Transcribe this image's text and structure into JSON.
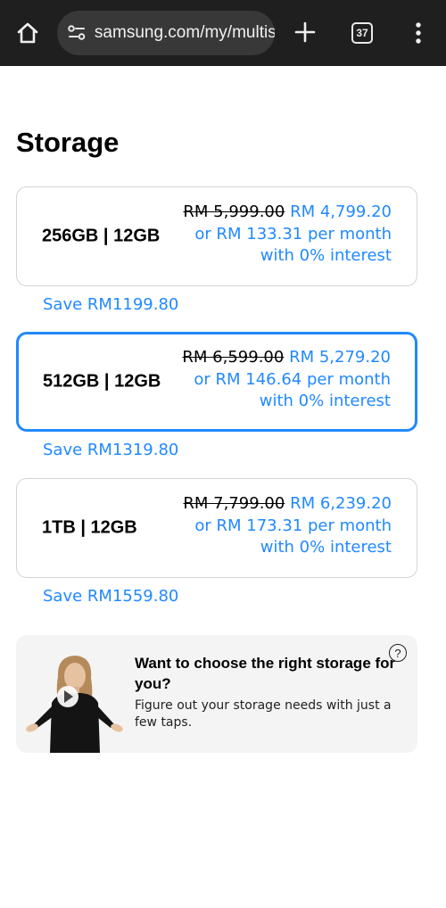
{
  "browser": {
    "url": "samsung.com/my/multisto",
    "tab_count": "37",
    "icons": {
      "home": "home-icon",
      "site_settings": "tune-icon",
      "new_tab": "plus-icon",
      "tabs": "tab-switcher-icon",
      "menu": "more-vert-icon"
    }
  },
  "storage": {
    "title": "Storage",
    "options": [
      {
        "name": "256GB | 12GB",
        "old_price": "RM 5,999.00",
        "new_price": "RM 4,799.20",
        "monthly": "or RM 133.31 per month",
        "interest": "with 0% interest",
        "save": "Save RM1199.80",
        "selected": false
      },
      {
        "name": "512GB | 12GB",
        "old_price": "RM 6,599.00",
        "new_price": "RM 5,279.20",
        "monthly": "or RM 146.64 per month",
        "interest": "with 0% interest",
        "save": "Save RM1319.80",
        "selected": true
      },
      {
        "name": "1TB | 12GB",
        "old_price": "RM 7,799.00",
        "new_price": "RM 6,239.20",
        "monthly": "or RM 173.31 per month",
        "interest": "with 0% interest",
        "save": "Save RM1559.80",
        "selected": false
      }
    ]
  },
  "help": {
    "title": "Want to choose the right storage for you?",
    "description": "Figure out your storage needs with just a few taps.",
    "info_symbol": "?"
  },
  "colors": {
    "accent": "#2189ff",
    "topbar": "#1f1f1f",
    "card_border": "#d4d4d4",
    "help_bg": "#f4f4f4"
  }
}
